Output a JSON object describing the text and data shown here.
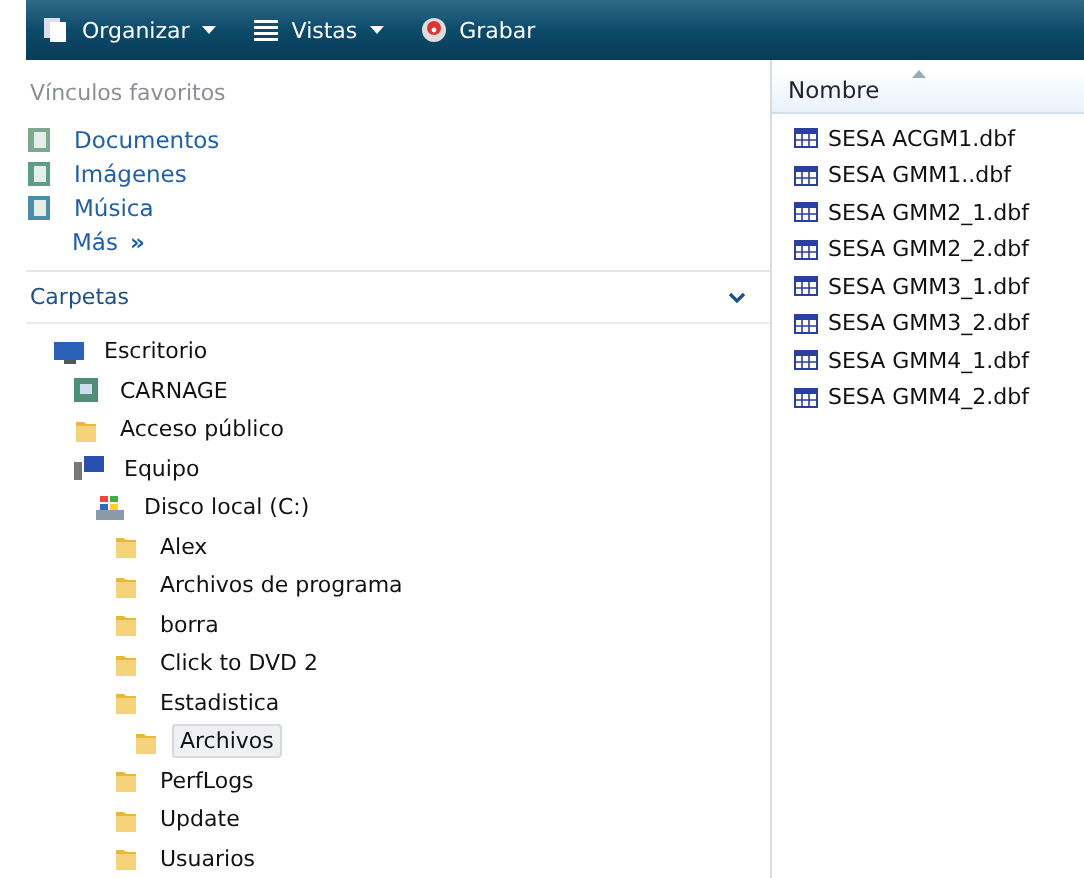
{
  "toolbar": [
    {
      "kind": "organize",
      "label": "Organizar",
      "dropdown": true
    },
    {
      "kind": "views",
      "label": "Vistas",
      "dropdown": true
    },
    {
      "kind": "burn",
      "label": "Grabar",
      "dropdown": false
    }
  ],
  "favorites": {
    "title": "Vínculos favoritos",
    "items": [
      {
        "kind": "documents",
        "label": "Documentos"
      },
      {
        "kind": "pictures",
        "label": "Imágenes"
      },
      {
        "kind": "music",
        "label": "Música"
      }
    ],
    "more": "Más",
    "more_glyph": "»"
  },
  "folders": {
    "title": "Carpetas",
    "tree": [
      {
        "label": "Escritorio",
        "kind": "desktop",
        "selected": false,
        "children": [
          {
            "label": "CARNAGE",
            "kind": "user",
            "selected": false
          },
          {
            "label": "Acceso público",
            "kind": "folder",
            "selected": false
          },
          {
            "label": "Equipo",
            "kind": "computer",
            "selected": false,
            "children": [
              {
                "label": "Disco local (C:)",
                "kind": "drive",
                "selected": false,
                "children": [
                  {
                    "label": "Alex",
                    "kind": "folder",
                    "selected": false
                  },
                  {
                    "label": "Archivos de programa",
                    "kind": "folder",
                    "selected": false
                  },
                  {
                    "label": "borra",
                    "kind": "folder",
                    "selected": false
                  },
                  {
                    "label": "Click to DVD 2",
                    "kind": "folder",
                    "selected": false
                  },
                  {
                    "label": "Estadistica",
                    "kind": "folder",
                    "selected": false,
                    "children": [
                      {
                        "label": "Archivos",
                        "kind": "folder",
                        "selected": true
                      }
                    ]
                  },
                  {
                    "label": "PerfLogs",
                    "kind": "folder",
                    "selected": false
                  },
                  {
                    "label": "Update",
                    "kind": "folder",
                    "selected": false
                  },
                  {
                    "label": "Usuarios",
                    "kind": "folder",
                    "selected": false
                  }
                ]
              }
            ]
          }
        ]
      }
    ]
  },
  "files": {
    "column": "Nombre",
    "items": [
      "SESA ACGM1.dbf",
      "SESA GMM1..dbf",
      "SESA GMM2_1.dbf",
      "SESA GMM2_2.dbf",
      "SESA GMM3_1.dbf",
      "SESA GMM3_2.dbf",
      "SESA GMM4_1.dbf",
      "SESA GMM4_2.dbf"
    ]
  }
}
